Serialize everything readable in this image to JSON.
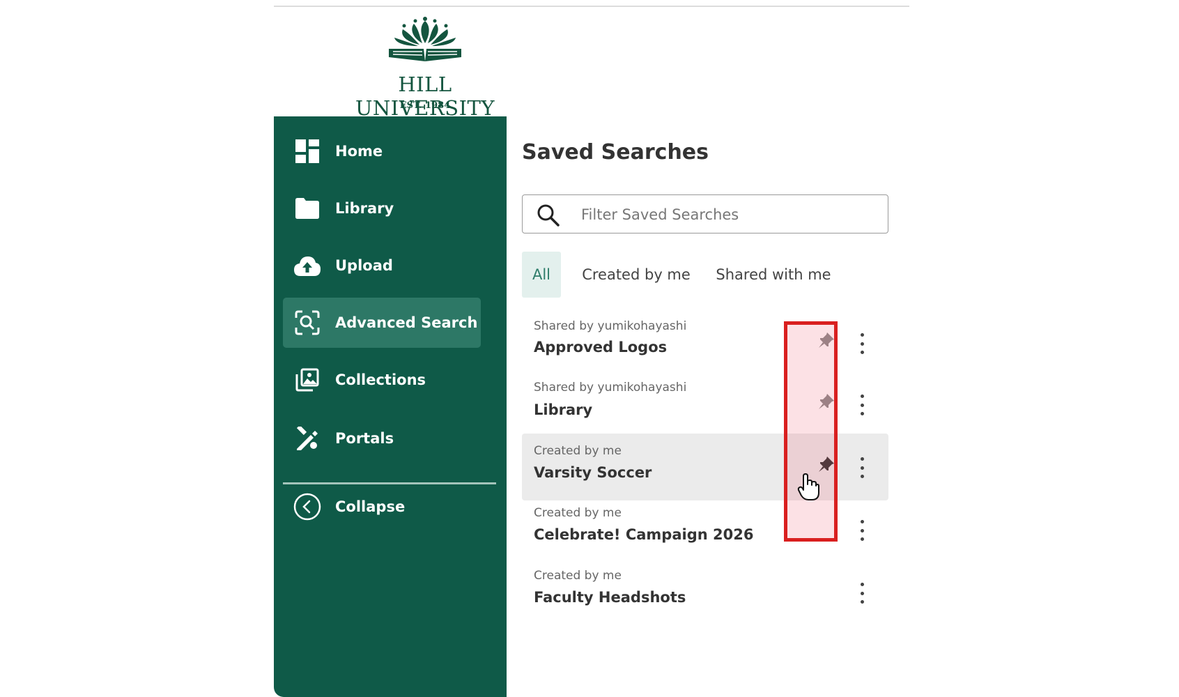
{
  "brand": {
    "name": "HILL UNIVERSITY",
    "tagline": "EST. 1984",
    "color": "#14553f"
  },
  "sidebar": {
    "background": "#0f5a48",
    "items": [
      {
        "label": "Home",
        "icon": "dashboard-icon",
        "active": false
      },
      {
        "label": "Library",
        "icon": "folder-icon",
        "active": false
      },
      {
        "label": "Upload",
        "icon": "cloud-upload-icon",
        "active": false
      },
      {
        "label": "Advanced Search",
        "icon": "scan-search-icon",
        "active": true
      },
      {
        "label": "Collections",
        "icon": "collections-icon",
        "active": false
      },
      {
        "label": "Portals",
        "icon": "portals-icon",
        "active": false
      }
    ],
    "collapse_label": "Collapse"
  },
  "main": {
    "title": "Saved Searches",
    "search": {
      "placeholder": "Filter Saved Searches",
      "value": ""
    },
    "tabs": [
      {
        "label": "All",
        "active": true
      },
      {
        "label": "Created by me",
        "active": false
      },
      {
        "label": "Shared with me",
        "active": false
      }
    ],
    "items": [
      {
        "source": "Shared by yumikohayashi",
        "name": "Approved Logos",
        "pin_visible": true,
        "hovered": false
      },
      {
        "source": "Shared by yumikohayashi",
        "name": "Library",
        "pin_visible": true,
        "hovered": false
      },
      {
        "source": "Created by me",
        "name": "Varsity Soccer",
        "pin_visible": true,
        "hovered": true
      },
      {
        "source": "Created by me",
        "name": "Celebrate! Campaign 2026",
        "pin_visible": false,
        "hovered": false
      },
      {
        "source": "Created by me",
        "name": "Faculty Headshots",
        "pin_visible": false,
        "hovered": false
      }
    ]
  },
  "annotation": {
    "highlight_color": "#d91f1f"
  }
}
